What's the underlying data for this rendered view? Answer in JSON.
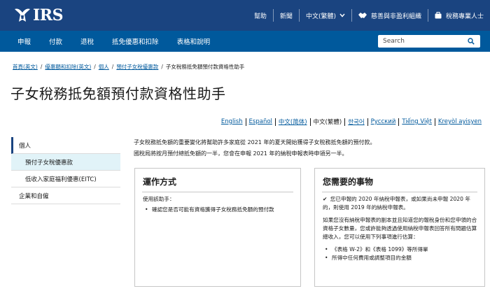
{
  "header": {
    "logo_text": "IRS",
    "links": [
      {
        "label": "幫助"
      },
      {
        "label": "新聞"
      },
      {
        "label": "中文(繁體)"
      },
      {
        "label": "慈善與非盈利組織"
      },
      {
        "label": "稅務專業人士"
      }
    ]
  },
  "nav": {
    "items": [
      "申報",
      "付款",
      "退稅",
      "抵免優惠和扣除",
      "表格和說明"
    ],
    "search_placeholder": "Search"
  },
  "breadcrumb": {
    "items": [
      "首頁(英文)",
      "優惠額和扣除(英文)",
      "個人",
      "預付子女稅優惠款"
    ],
    "current": "子女稅務抵免額預付款資格性助手"
  },
  "page": {
    "title": "子女稅務抵免額預付款資格性助手"
  },
  "languages": {
    "items": [
      "English",
      "Español",
      "中文(简体)",
      "中文(繁體)",
      "한국어",
      "Русский",
      "Tiếng Việt",
      "Kreyòl ayisyen"
    ],
    "current_index": 3
  },
  "sidebar": {
    "items": [
      {
        "label": "個人"
      },
      {
        "label": "預付子女稅優惠款"
      },
      {
        "label": "低收入家庭福利優惠(EITC)"
      },
      {
        "label": "企業和自僱"
      }
    ]
  },
  "main": {
    "intro_1": "子女稅務抵免額的重要變化將幫助許多家庭從 2021 年的夏天開始獲得子女稅務抵免額的預付款。",
    "intro_2": "國稅局將按月預付總抵免額的一半，您會在申報 2021 年的納稅申報表時申領另一半。",
    "card1": {
      "title": "運作方式",
      "text": "使用該助手：",
      "bullets": [
        "確認您是否可能有資格獲得子女稅務抵免額的預付款"
      ]
    },
    "card2": {
      "title": "您需要的事物",
      "check_text": "您已申報的 2020 年納稅申報表，或如果尚未申報 2020 年的，則使用 2019 年的納稅申報表。",
      "text": "如果您沒有納稅申報表的副本並且知道您的報稅身份和您申領的合資格子女數量，您或許能夠透過使用納稅申報表回答所有問題估算總收入，您可以使用下列事項進行估算：",
      "bullets": [
        "《表格 W-2》和《表格 1099》等所得單",
        "所得中任何費用或調整項目的金額"
      ]
    },
    "check_icon": "✔"
  },
  "colors": {
    "header_bg": "#1a4480",
    "nav_bg": "#00599c",
    "link": "#00599c",
    "sidebar_active_bg": "#e1f3f8"
  }
}
